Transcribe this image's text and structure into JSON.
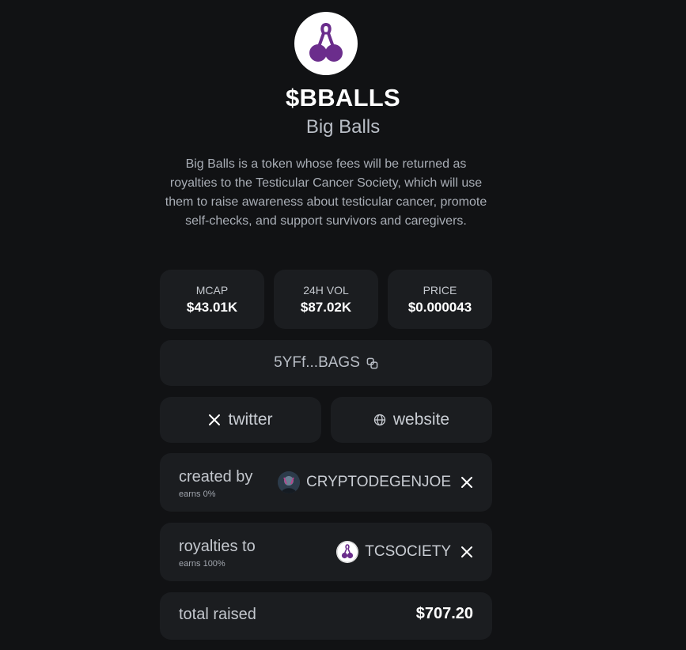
{
  "token": {
    "ticker": "$BBALLS",
    "name": "Big Balls",
    "description": "Big Balls is a token whose fees will be returned as royalties to the Testicular Cancer Society, which will use them to raise awareness about testicular cancer, promote self-checks, and support survivors and caregivers.",
    "logo_icon": "cherry-ribbon-icon"
  },
  "stats": [
    {
      "label": "MCAP",
      "value": "$43.01K"
    },
    {
      "label": "24H VOL",
      "value": "$87.02K"
    },
    {
      "label": "PRICE",
      "value": "$0.000043"
    }
  ],
  "address": {
    "short": "5YFf...BAGS",
    "icon": "copy-icon"
  },
  "links": {
    "twitter": {
      "label": "twitter",
      "icon": "x-icon"
    },
    "website": {
      "label": "website",
      "icon": "globe-icon"
    }
  },
  "creator": {
    "title": "created by",
    "earns": "earns 0%",
    "handle": "CRYPTODEGENJOE",
    "avatar_icon": "creator-avatar",
    "social_icon": "x-icon"
  },
  "royalties": {
    "title": "royalties to",
    "earns": "earns 100%",
    "handle": "TCSOCIETY",
    "avatar_icon": "tcsociety-avatar",
    "social_icon": "x-icon"
  },
  "raised": {
    "label": "total raised",
    "value": "$707.20"
  },
  "colors": {
    "background": "#111214",
    "card": "#1b1d20",
    "accent_purple": "#6b2d8c"
  }
}
